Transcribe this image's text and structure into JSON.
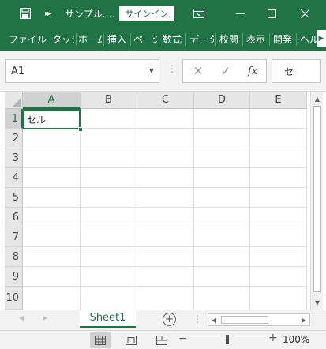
{
  "titlebar": {
    "document_title": "サンプル.…",
    "signin_label": "サインイン"
  },
  "ribbon": {
    "tabs": [
      {
        "label": "ファイル"
      },
      {
        "label": "タッチ"
      },
      {
        "label": "ホーム"
      },
      {
        "label": "挿入"
      },
      {
        "label": "ページ"
      },
      {
        "label": "数式"
      },
      {
        "label": "データ"
      },
      {
        "label": "校閲"
      },
      {
        "label": "表示"
      },
      {
        "label": "開発"
      },
      {
        "label": "ヘル"
      }
    ]
  },
  "formula_bar": {
    "name_box": "A1",
    "fx_label": "fx",
    "content": "セ"
  },
  "grid": {
    "columns": [
      "A",
      "B",
      "C",
      "D",
      "E"
    ],
    "rows": [
      "1",
      "2",
      "3",
      "4",
      "5",
      "6",
      "7",
      "8",
      "9",
      "10"
    ],
    "selected_cell_value": "セル"
  },
  "sheets": {
    "active_sheet": "Sheet1"
  },
  "status": {
    "zoom": "100%"
  },
  "colors": {
    "accent": "#217346"
  }
}
